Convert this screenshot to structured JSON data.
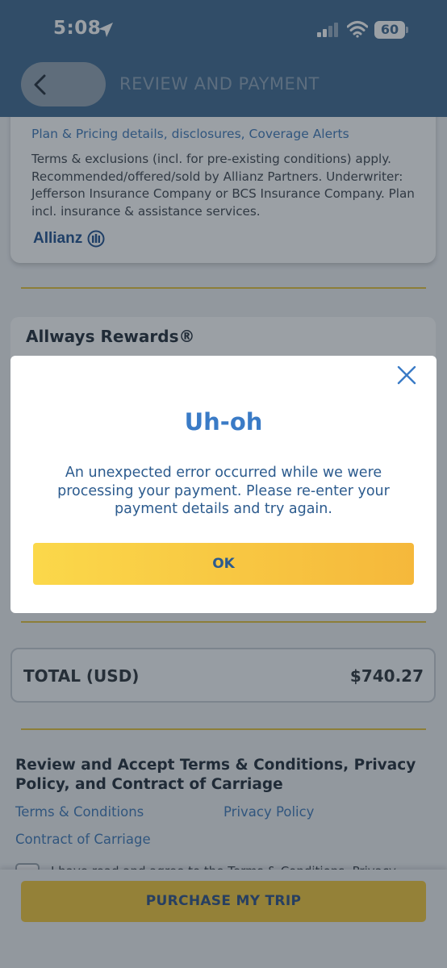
{
  "status_bar": {
    "time": "5:08",
    "battery": "60"
  },
  "header": {
    "title": "REVIEW AND PAYMENT"
  },
  "plan": {
    "details_link": "Plan & Pricing details, disclosures, Coverage Alerts",
    "terms_text": "Terms & exclusions (incl. for pre-existing conditions) apply. Recommended/offered/sold by Allianz Partners. Underwriter: Jefferson Insurance Company or BCS Insurance Company. Plan incl. insurance & assistance services.",
    "logo_text": "Allianz"
  },
  "rewards": {
    "title": "Allways Rewards®"
  },
  "total": {
    "label": "TOTAL (USD)",
    "value": "$740.27"
  },
  "terms_section": {
    "heading": "Review and Accept Terms & Conditions, Privacy Policy, and Contract of Carriage",
    "links": {
      "terms": "Terms & Conditions",
      "privacy": "Privacy Policy",
      "carriage": "Contract of Carriage"
    },
    "agree_text": "I have read and agree to the Terms & Conditions, Privacy"
  },
  "purchase_button": "PURCHASE MY TRIP",
  "modal": {
    "title": "Uh-oh",
    "message": "An unexpected error occurred while we were processing your payment. Please re-enter your payment details and try again.",
    "ok_label": "OK"
  },
  "colors": {
    "header_bg": "#3e6891",
    "accent_yellow": "#f2c63a",
    "link_blue": "#3f78b8",
    "modal_title_blue": "#3a7bc6"
  },
  "icons": {
    "location": "location-arrow-icon",
    "signal": "cellular-signal-icon",
    "wifi": "wifi-icon",
    "battery": "battery-icon",
    "back": "chevron-left-icon",
    "close": "close-icon",
    "allianz": "allianz-logo-mark"
  }
}
